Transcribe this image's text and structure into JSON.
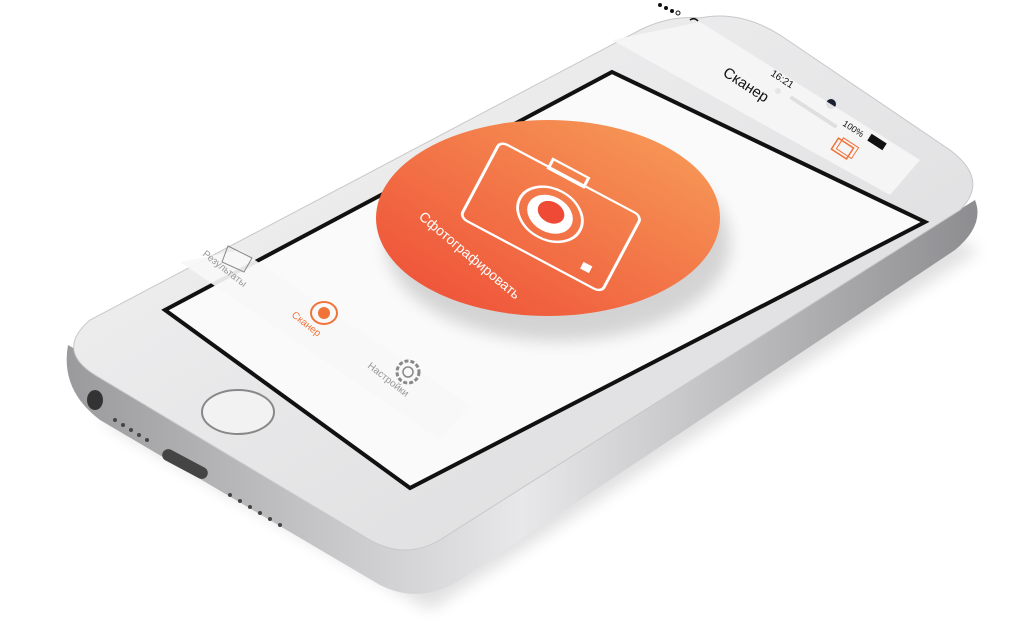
{
  "status_bar": {
    "time": "16:21",
    "battery": "100%"
  },
  "header": {
    "title": "Сканер"
  },
  "main": {
    "capture_button_label": "Сфотографировать"
  },
  "tab_bar": {
    "items": [
      {
        "label": "Результаты",
        "icon": "documents-icon"
      },
      {
        "label": "Сканер",
        "icon": "camera-lens-icon",
        "active": true
      },
      {
        "label": "Настройки",
        "icon": "gear-icon"
      }
    ]
  },
  "colors": {
    "accent": "#f0743a",
    "circle_start": "#f7a05a",
    "circle_end": "#ee4a35"
  }
}
